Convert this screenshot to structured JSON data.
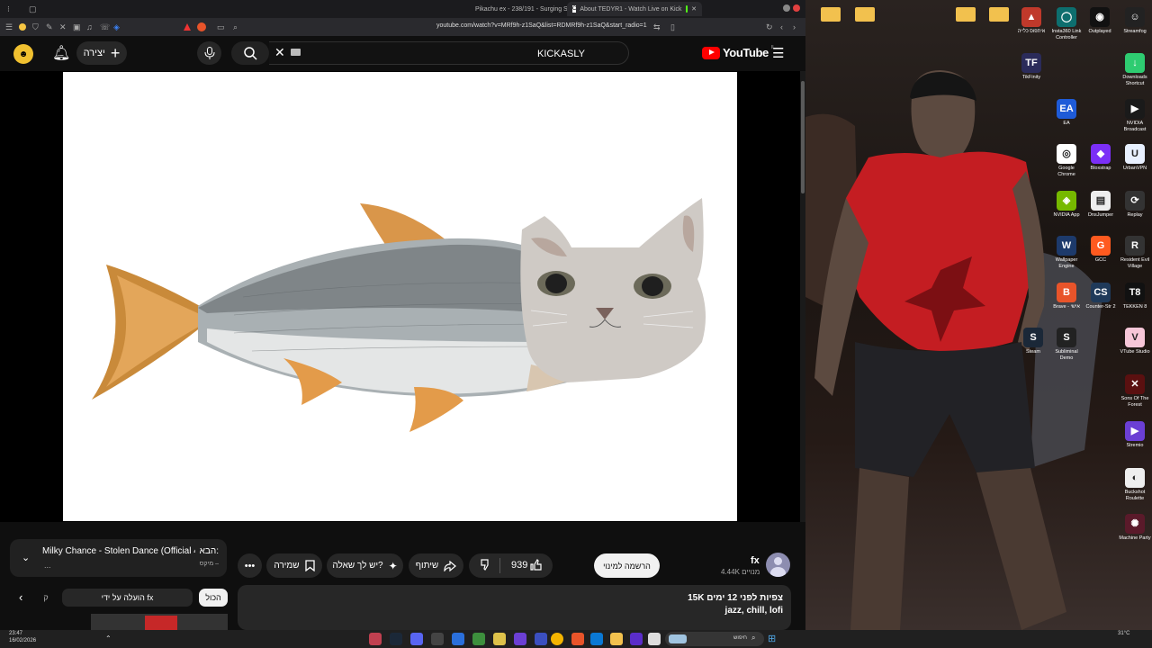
{
  "browser": {
    "tabs": [
      {
        "label": "Pikachu ex - 238/191 - Surging Spar",
        "active": false
      },
      {
        "label": "About TEDYR1 - Watch Live on Kick",
        "active": true
      }
    ],
    "url": "youtube.com/watch?v=MRf9h-z1SaQ&list=RDMRf9h-z1SaQ&start_radio=1"
  },
  "yt_header": {
    "create_label": "יצירה",
    "search_hint": "KICKASLY",
    "logo_text": "YouTube",
    "logo_region": "IL"
  },
  "video_actions": {
    "like_count": "939",
    "share_label": "שיתוף",
    "ask_label": "יש לך שאלה?",
    "save_label": "שמירה",
    "subscribe_label": "הרשמה למינוי"
  },
  "channel": {
    "name": "fx",
    "subscribers": "4.44K מנויים"
  },
  "next_up": {
    "prefix": "הבא:",
    "title": "Milky Chance - Stolen Dance (Official 4K...",
    "mix_label": "מיקס –",
    "dots": "..."
  },
  "chips": {
    "all_label": "הכול",
    "uploaded_by_label": "הועלה על ידי fx"
  },
  "description": {
    "stats": "15K צפיות לפני 12 ימים",
    "tags": "jazz, chill, lofi"
  },
  "desktop_icons": [
    {
      "label": "Streamfog",
      "color": "#222",
      "glyph": "☺"
    },
    {
      "label": "Outplayed",
      "color": "#111",
      "glyph": "◉"
    },
    {
      "label": "Insta360 Link Controller",
      "color": "#0d6e6e",
      "glyph": "◯"
    },
    {
      "label": "איתפוס כלייה",
      "color": "#c0392b",
      "glyph": "▲"
    },
    {
      "label": "Downloads Shortcut",
      "color": "#2ecc71",
      "glyph": "↓"
    },
    {
      "label": "TikFinity",
      "color": "#2b2b5a",
      "glyph": "TF"
    },
    {
      "label": "NVIDIA Broadcast",
      "color": "#1a1a1a",
      "glyph": "▶"
    },
    {
      "label": "EA",
      "color": "#1e5bd8",
      "glyph": "EA"
    },
    {
      "label": "UrbanVPN",
      "color": "#e8f0ff",
      "glyph": "U"
    },
    {
      "label": "Bloxstrap",
      "color": "#7b2ff7",
      "glyph": "◆"
    },
    {
      "label": "Google Chrome",
      "color": "#ffffff",
      "glyph": "◎"
    },
    {
      "label": "Replay",
      "color": "#333",
      "glyph": "⟳"
    },
    {
      "label": "DnsJumper",
      "color": "#eee",
      "glyph": "▤"
    },
    {
      "label": "NVIDIA App",
      "color": "#76b900",
      "glyph": "◈"
    },
    {
      "label": "Resident Evil Village",
      "color": "#333",
      "glyph": "R"
    },
    {
      "label": "GCC",
      "color": "#ff5a1f",
      "glyph": "G"
    },
    {
      "label": "Wallpaper Engine",
      "color": "#1d3a6b",
      "glyph": "W"
    },
    {
      "label": "TEKKEN 8",
      "color": "#111",
      "glyph": "T8"
    },
    {
      "label": "Counter-Str 2",
      "color": "#1f3a5a",
      "glyph": "CS"
    },
    {
      "label": "Brave - אישי",
      "color": "#e8542a",
      "glyph": "B"
    },
    {
      "label": "VTube Studio",
      "color": "#f7c6d8",
      "glyph": "V"
    },
    {
      "label": "Subliminal Demo",
      "color": "#222",
      "glyph": "S"
    },
    {
      "label": "Steam",
      "color": "#1b2838",
      "glyph": "S"
    },
    {
      "label": "Sons Of The Forest",
      "color": "#5a1010",
      "glyph": "✕"
    },
    {
      "label": "Stremio",
      "color": "#6b3fd4",
      "glyph": "▶"
    },
    {
      "label": "Buckshot Roulette",
      "color": "#eee",
      "glyph": "◐"
    },
    {
      "label": "Machine Party",
      "color": "#5a1a2a",
      "glyph": "✺"
    }
  ],
  "taskbar": {
    "time": "23:47",
    "date": "16/02/2026",
    "weather": "31°C",
    "search_label": "חיפוש"
  }
}
